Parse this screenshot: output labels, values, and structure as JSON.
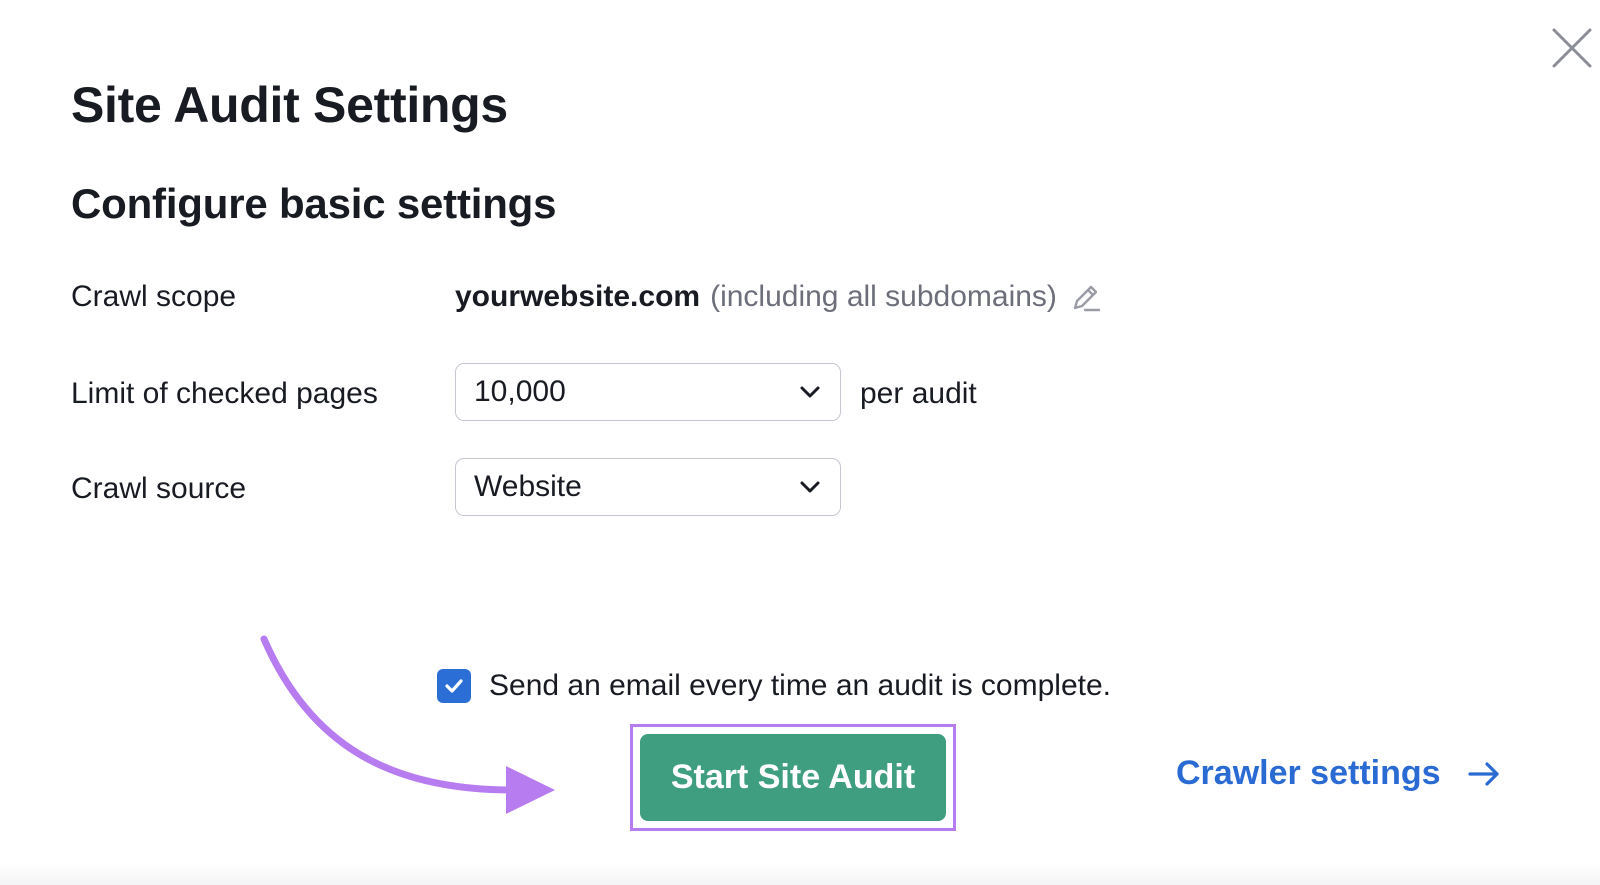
{
  "dialog": {
    "title": "Site Audit Settings",
    "subtitle": "Configure basic settings"
  },
  "settings": {
    "crawl_scope": {
      "label": "Crawl scope",
      "domain": "yourwebsite.com",
      "note": "(including all subdomains)"
    },
    "page_limit": {
      "label": "Limit of checked pages",
      "value": "10,000",
      "suffix": "per audit"
    },
    "crawl_source": {
      "label": "Crawl source",
      "value": "Website"
    }
  },
  "email_option": {
    "label": "Send an email every time an audit is complete.",
    "checked": true
  },
  "actions": {
    "start_label": "Start Site Audit",
    "crawler_settings_label": "Crawler settings"
  },
  "colors": {
    "primary_button": "#3f9d80",
    "link": "#2a6ad3",
    "checkbox": "#2b6fd6",
    "annotation": "#b77cf0"
  },
  "icons": {
    "close": "close-icon",
    "edit": "pencil-icon",
    "dropdown": "chevron-down-icon",
    "check": "check-icon",
    "link_arrow": "arrow-right-icon",
    "annotation_arrow": "curved-arrow-icon"
  }
}
